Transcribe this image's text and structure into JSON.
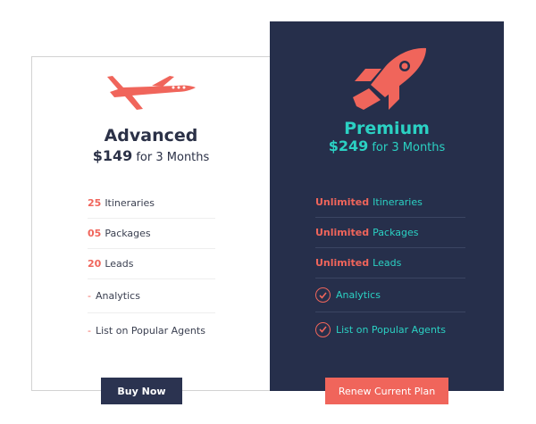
{
  "plans": {
    "advanced": {
      "name": "Advanced",
      "price": "$149",
      "period": "for 3 Months",
      "icon": "airplane-icon",
      "features": [
        {
          "highlight": "25",
          "text": "Itineraries"
        },
        {
          "highlight": "05",
          "text": "Packages"
        },
        {
          "highlight": "20",
          "text": "Leads"
        },
        {
          "prefix": "-",
          "text": "Analytics"
        },
        {
          "prefix": "-",
          "text": "List on Popular Agents"
        }
      ],
      "button_label": "Buy Now"
    },
    "premium": {
      "name": "Premium",
      "price": "$249",
      "period": "for 3 Months",
      "icon": "rocket-icon",
      "features": [
        {
          "highlight": "Unlimited",
          "text": "Itineraries"
        },
        {
          "highlight": "Unlimited",
          "text": "Packages"
        },
        {
          "highlight": "Unlimited",
          "text": "Leads"
        },
        {
          "icon": "check-circle-icon",
          "text": "Analytics"
        },
        {
          "icon": "check-circle-icon",
          "text": "List on Popular Agents"
        }
      ],
      "button_label": "Renew Current Plan"
    }
  },
  "colors": {
    "accent": "#f0655b",
    "teal": "#2bd1c3",
    "navy": "#262f4b",
    "button_navy": "#2b3350"
  }
}
